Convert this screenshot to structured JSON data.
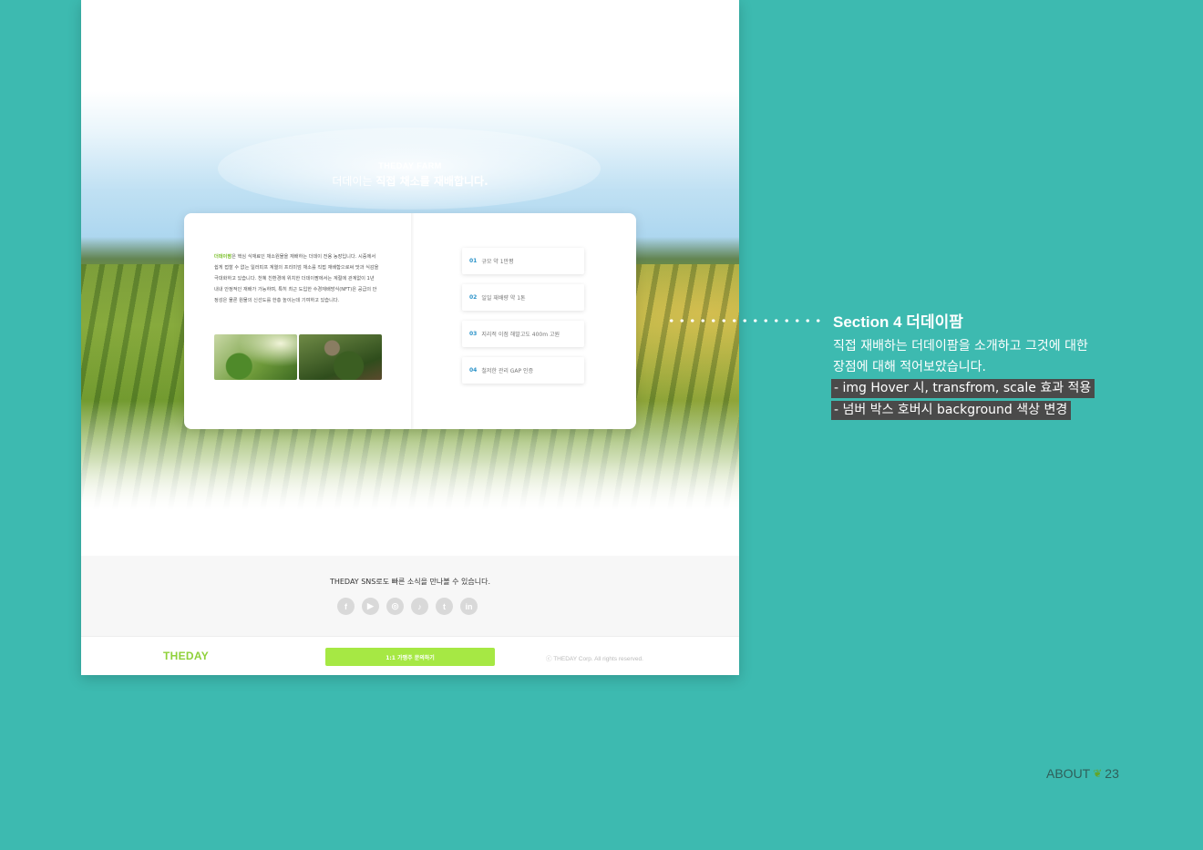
{
  "hero": {
    "kicker": "THEDAY FARM",
    "title_plain": "더데이는 ",
    "title_bold": "직접 채소를 재배합니다."
  },
  "intro": {
    "highlight": "더데이팜",
    "text": "은 핵심 식재료인 채소원물을 재배하는 더데이 전용 농장입니다. 시중에서 쉽게 접할 수 없는 일러피프 계열의 프리미엄 채소를 직접 재배함으로써 맛과 식감을 극대화하고 있습니다. 천혜 친환경에 위치한 더데이팜에서는 계절에 관계없이 1년 내내 안정적인 재배가 가능하며, 특히 최근 도입한 수경재배방식(NFT)은 공급의 안정성은 물론 원물의 신선도를 한층 높이는데 기여하고 있습니다."
  },
  "features": [
    {
      "num": "01",
      "label": "규모 약 1만평"
    },
    {
      "num": "02",
      "label": "일일 재배량 약 1톤"
    },
    {
      "num": "03",
      "label": "지리적 이점 해발고도 400m 고원"
    },
    {
      "num": "04",
      "label": "철저한 관리 GAP 인증"
    }
  ],
  "sns": {
    "title": "THEDAY SNS로도 빠른 소식을 만나볼 수 있습니다.",
    "icons": [
      {
        "name": "facebook-icon",
        "glyph": "f"
      },
      {
        "name": "youtube-icon",
        "glyph": "▶"
      },
      {
        "name": "instagram-icon",
        "glyph": "◎"
      },
      {
        "name": "tiktok-icon",
        "glyph": "♪"
      },
      {
        "name": "twitter-icon",
        "glyph": "t"
      },
      {
        "name": "linkedin-icon",
        "glyph": "in"
      }
    ]
  },
  "footer": {
    "logo": "THEDAY",
    "cta": "1:1 가맹주 문의하기",
    "copyright": "ⓒ THEDAY Corp. All rights reserved."
  },
  "description": {
    "title": "Section 4 더데이팜",
    "line1": "직접 재배하는 더데이팜을 소개하고 그것에 대한",
    "line2": "장점에 대해 적어보았습니다.",
    "tag1": "- img Hover 시, transfrom, scale 효과 적용",
    "tag2": "- 넘버 박스 호버시 background 색상 변경"
  },
  "page": {
    "label": "ABOUT",
    "number": "23"
  },
  "colors": {
    "background": "#3dbab0",
    "accent_green": "#a6e844",
    "number_blue": "#2b93c9",
    "tag_bg": "#4a4a4a"
  }
}
